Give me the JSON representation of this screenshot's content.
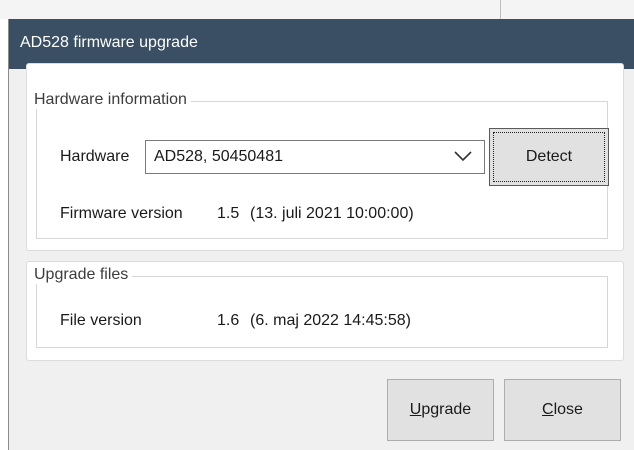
{
  "window": {
    "title": "AD528  firmware upgrade"
  },
  "hardware_group": {
    "legend": "Hardware information",
    "hardware_label": "Hardware",
    "hardware_selected": "AD528, 50450481",
    "detect_label": "Detect",
    "firmware_label": "Firmware version",
    "firmware_version": "1.5",
    "firmware_date": "(13. juli 2021 10:00:00)"
  },
  "upgrade_group": {
    "legend": "Upgrade files",
    "file_label": "File version",
    "file_version": "1.6",
    "file_date": "(6. maj 2022 14:45:58)"
  },
  "buttons": {
    "upgrade_mnemonic": "U",
    "upgrade_rest": "pgrade",
    "close_mnemonic": "C",
    "close_rest": "lose"
  },
  "icons": {
    "dropdown": "chevron-down-icon"
  },
  "colors": {
    "title_bar": "#3a4f63",
    "dialog_bg": "#f0f0f0",
    "panel_bg": "#ffffff"
  }
}
